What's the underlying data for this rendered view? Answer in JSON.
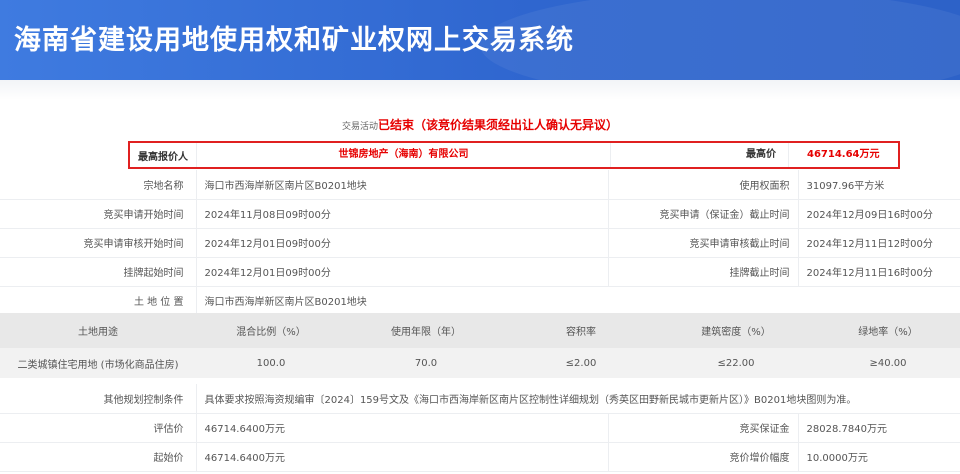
{
  "header": {
    "title": "海南省建设用地使用权和矿业权网上交易系统"
  },
  "status": {
    "label": "交易活动",
    "state": "已结束",
    "note": "（该竞价结果须经出让人确认无异议）"
  },
  "highest_bid": {
    "bidder_label": "最高报价人",
    "bidder": "世锦房地产（海南）有限公司",
    "price_label": "最高价",
    "price": "46714.64万元"
  },
  "info_rows": [
    {
      "l1": "宗地名称",
      "v1": "海口市西海岸新区南片区B0201地块",
      "l2": "使用权面积",
      "v2": "31097.96平方米"
    },
    {
      "l1": "竞买申请开始时间",
      "v1": "2024年11月08日09时00分",
      "l2": "竞买申请（保证金）截止时间",
      "v2": "2024年12月09日16时00分"
    },
    {
      "l1": "竞买申请审核开始时间",
      "v1": "2024年12月01日09时00分",
      "l2": "竞买申请审核截止时间",
      "v2": "2024年12月11日12时00分"
    },
    {
      "l1": "挂牌起始时间",
      "v1": "2024年12月01日09时00分",
      "l2": "挂牌截止时间",
      "v2": "2024年12月11日16时00分"
    }
  ],
  "location": {
    "label": "土 地 位 置",
    "value": "海口市西海岸新区南片区B0201地块"
  },
  "land_use": {
    "headers": [
      "土地用途",
      "混合比例（%）",
      "使用年限（年）",
      "容积率",
      "建筑密度（%）",
      "绿地率（%）"
    ],
    "row": [
      "二类城镇住宅用地 (市场化商品住房)",
      "100.0",
      "70.0",
      "≤2.00",
      "≤22.00",
      "≥40.00"
    ]
  },
  "planning": {
    "label": "其他规划控制条件",
    "value": "具体要求按照海资规编审〔2024〕159号文及《海口市西海岸新区南片区控制性详细规划（秀英区田野新民城市更新片区）》B0201地块图则为准。"
  },
  "price_rows": [
    {
      "l1": "评估价",
      "v1": "46714.6400万元",
      "l2": "竞买保证金",
      "v2": "28028.7840万元"
    },
    {
      "l1": "起始价",
      "v1": "46714.6400万元",
      "l2": "竞价增价幅度",
      "v2": "10.0000万元"
    }
  ]
}
